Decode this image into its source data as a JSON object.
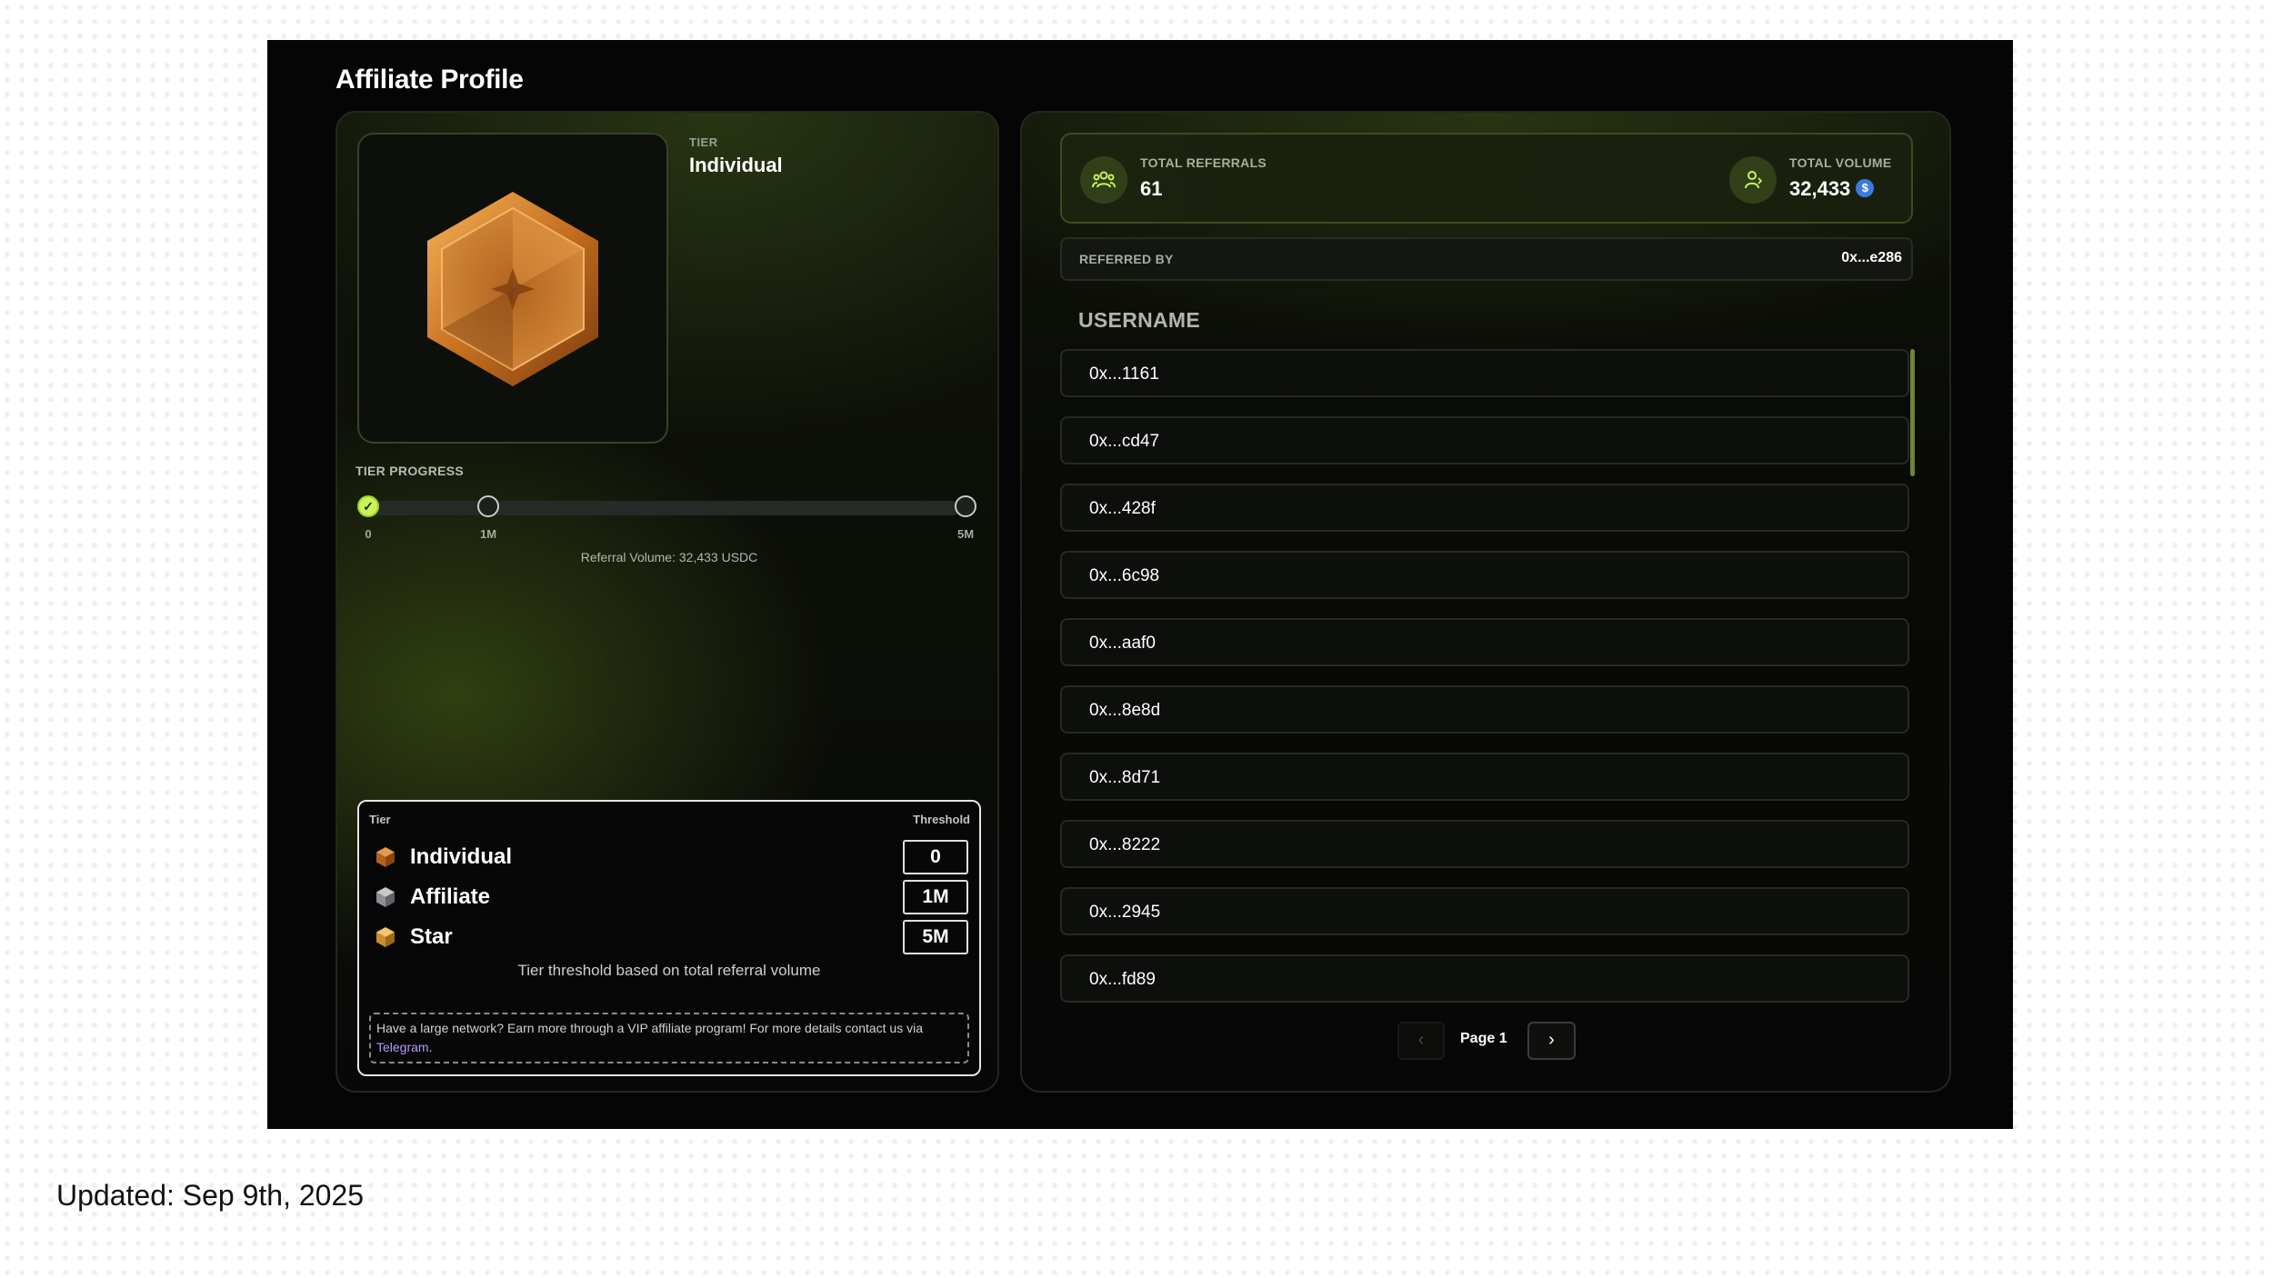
{
  "page_title": "Affiliate Profile",
  "profile": {
    "tier_label": "TIER",
    "tier_value": "Individual",
    "badge_icon": "bronze-hexagon-badge",
    "progress": {
      "label": "TIER PROGRESS",
      "ticks": [
        "0",
        "1M",
        "5M"
      ],
      "volume_text": "Referral Volume: 32,433 USDC",
      "completed_fraction": 0
    }
  },
  "tier_table": {
    "header_tier": "Tier",
    "header_threshold": "Threshold",
    "rows": [
      {
        "name": "Individual",
        "threshold": "0",
        "color": "#c97a2b"
      },
      {
        "name": "Affiliate",
        "threshold": "1M",
        "color": "#8e9298"
      },
      {
        "name": "Star",
        "threshold": "5M",
        "color": "#d9a040"
      }
    ],
    "note": "Tier threshold based on total referral volume",
    "vip_text": "Have a large network? Earn more through a VIP affiliate program! For more details contact us via ",
    "vip_link": "Telegram",
    "vip_end": "."
  },
  "stats": {
    "referrals_label": "TOTAL REFERRALS",
    "referrals_value": "61",
    "volume_label": "TOTAL VOLUME",
    "volume_value": "32,433",
    "volume_currency_icon": "usdc-coin-icon"
  },
  "referred_by": {
    "label": "REFERRED BY",
    "value": "0x...e286"
  },
  "users": {
    "header": "USERNAME",
    "rows": [
      "0x...1161",
      "0x...cd47",
      "0x...428f",
      "0x...6c98",
      "0x...aaf0",
      "0x...8e8d",
      "0x...8d71",
      "0x...8222",
      "0x...2945",
      "0x...fd89"
    ]
  },
  "pagination": {
    "prev_icon": "chevron-left-icon",
    "label": "Page 1",
    "next_icon": "chevron-right-icon"
  },
  "updated_caption": "Updated: Sep 9th, 2025",
  "colors": {
    "accent": "#c9f25b",
    "link": "#b69cff",
    "usdc": "#3b7be0"
  }
}
